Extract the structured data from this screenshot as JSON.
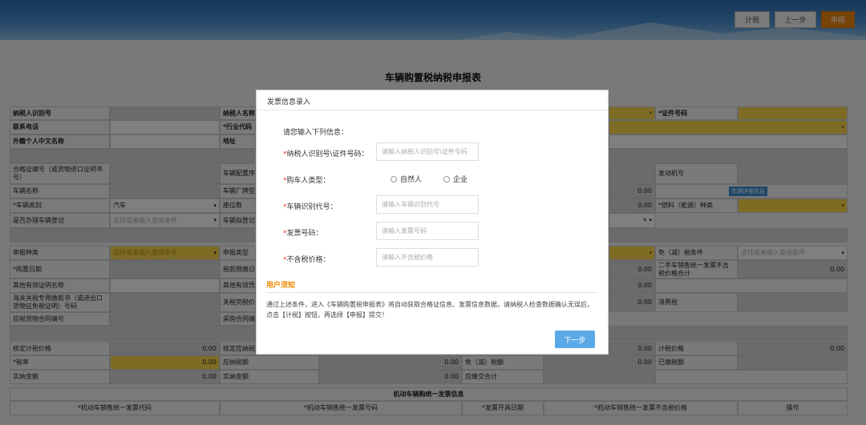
{
  "toolbar": {
    "calc": "计税",
    "prev": "上一步",
    "submit": "申报"
  },
  "form_title": "车辆购置税纳税申报表",
  "form": {
    "taxpayer_id": "纳税人识别号",
    "taxpayer_name": "纳税人名称",
    "cert_no": "*证件号码",
    "phone": "联系电话",
    "industry": "*行业代码",
    "foreign_name": "外籍个人中文名称",
    "address": "地址",
    "cert_no2": "合格证编号（或货物进口证明书号）",
    "config_no": "车辆配置序号",
    "engine_no": "发动机号",
    "vehicle_name": "车辆名称",
    "maker": "车辆厂牌型号",
    "vehicle_detail_btn": "车辆详细信息",
    "vehicle_type": "*车辆类别",
    "vehicle_type_val": "汽车",
    "seats": "座位数",
    "fuel": "*燃料（能源）种类",
    "register": "是否办理车辆登记",
    "register_ph": "选择或者输入查询条件",
    "register_place": "车辆拟登记地",
    "declare_type": "申报种类",
    "declare_type_ph": "选择或者输入查询条件",
    "report_type": "申报类型",
    "exempt": "免（减）税条件",
    "exempt_ph": "选择或者输入查询条件",
    "purchase_date": "*购置日期",
    "tax_date": "税款限缴日期",
    "used_invoice": "二手车销售统一发票不含税价格合计",
    "other_cert": "其他有效证明名称",
    "other_cert2": "其他有效凭证",
    "customs_no": "海关关税专用缴款书（或进出口货物征免税证明）号码",
    "customs_price": "关税完税价格",
    "consumption_tax": "消费税",
    "contract_no": "应税货物合同编号",
    "contract2": "采购合同编号",
    "zero": "0.00",
    "verify_price": "核定计税价格",
    "verify_tax": "核定应纳税额",
    "tax_price": "计税价格",
    "rate": "*税率",
    "payable": "应纳税额",
    "exempt_tax": "免（减）税额",
    "paid": "已缴税额",
    "actual": "实纳金额",
    "actual_amount": "实纳金额",
    "refund_total": "应缴交合计",
    "invoice_title": "机动车辆购统一发票信息",
    "inv_code": "*机动车销售统一发票代码",
    "inv_no": "*机动车销售统一发票号码",
    "inv_date": "*发票开具日期",
    "inv_price": "*机动车销售统一发票不含税价格",
    "op": "操作"
  },
  "dialog": {
    "title": "发票信息录入",
    "prompt": "请您输入下列信息：",
    "f1_label": "纳税人识别号\\证件号码：",
    "f1_ph": "请输入纳税人识别号\\证件号码",
    "f2_label": "购车人类型：",
    "opt_person": "自然人",
    "opt_company": "企业",
    "f3_label": "车辆识别代号：",
    "f3_ph": "请输入车辆识别代号",
    "f4_label": "发票号码：",
    "f4_ph": "请输入发票号码",
    "f5_label": "不含税价格：",
    "f5_ph": "请输入不含税价格",
    "notice_title": "用户须知",
    "notice_text": "通过上述条件，进入《车辆购置税申报表》将自动获取合格证信息、发票信息数据，请纳税人检查数据确认无误后，点击【计税】按钮，再选择【申报】提交！",
    "next": "下一步"
  }
}
